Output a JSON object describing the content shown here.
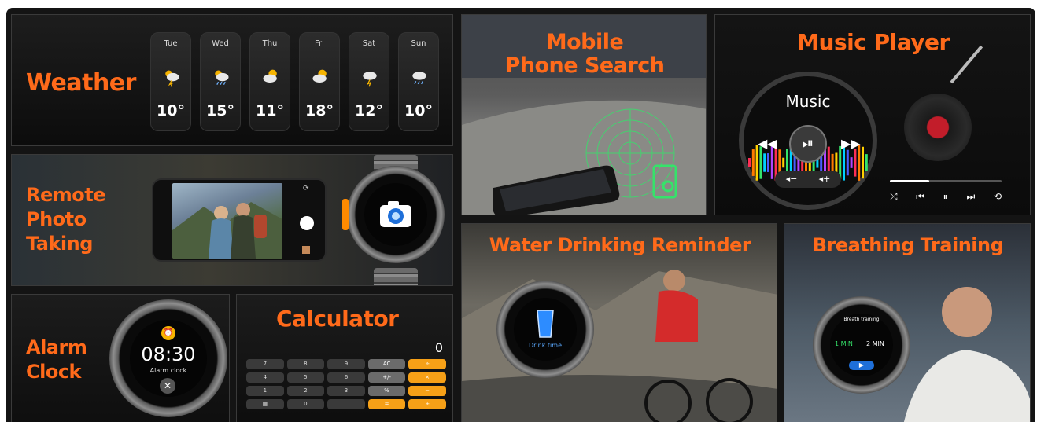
{
  "weather": {
    "title": "Weather",
    "days": [
      {
        "day": "Tue",
        "temp": "10°",
        "icon": "thunderstorm-sun-icon"
      },
      {
        "day": "Wed",
        "temp": "15°",
        "icon": "rain-sun-icon"
      },
      {
        "day": "Thu",
        "temp": "11°",
        "icon": "partly-cloudy-icon"
      },
      {
        "day": "Fri",
        "temp": "18°",
        "icon": "partly-cloudy-icon"
      },
      {
        "day": "Sat",
        "temp": "12°",
        "icon": "thunderstorm-icon"
      },
      {
        "day": "Sun",
        "temp": "10°",
        "icon": "rain-icon"
      }
    ]
  },
  "photo": {
    "title_line1": "Remote",
    "title_line2": "Photo",
    "title_line3": "Taking"
  },
  "alarm": {
    "title_line1": "Alarm",
    "title_line2": "Clock",
    "time": "08:30",
    "label": "Alarm clock"
  },
  "calculator": {
    "title": "Calculator",
    "display": "0",
    "keys": [
      "7",
      "8",
      "9",
      "AC",
      "÷",
      "4",
      "5",
      "6",
      "+/-",
      "×",
      "1",
      "2",
      "3",
      "%",
      "−",
      "▦",
      "0",
      ".",
      "=",
      "+"
    ]
  },
  "search": {
    "title_line1": "Mobile",
    "title_line2": "Phone Search"
  },
  "music": {
    "title": "Music Player",
    "screen_label": "Music"
  },
  "water": {
    "title": "Water Drinking Reminder",
    "watch_label": "Drink time"
  },
  "breath": {
    "title": "Breathing Training",
    "watch_title": "Breath training",
    "opt1": "1 MIN",
    "opt2": "2 MIN"
  },
  "colors": {
    "accent": "#ff6a1a",
    "calc_op": "#f6a017",
    "green": "#35e36a"
  }
}
